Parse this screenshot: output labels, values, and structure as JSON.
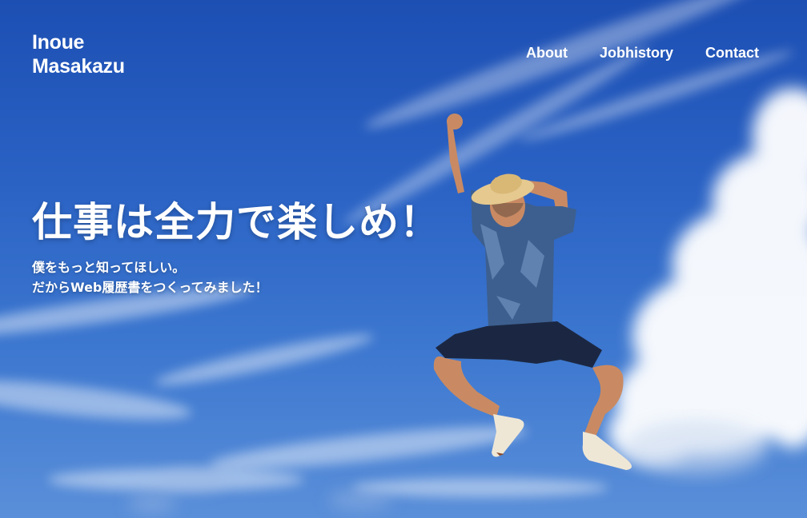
{
  "logo": {
    "line1": "Inoue",
    "line2": "Masakazu"
  },
  "nav": {
    "items": [
      {
        "label": "About"
      },
      {
        "label": "Jobhistory"
      },
      {
        "label": "Contact"
      }
    ]
  },
  "hero": {
    "headline": "仕事は全力で楽しめ！",
    "subtext_line1": "僕をもっと知ってほしい。",
    "subtext_line2": "だからWeb履歴書をつくってみました！"
  },
  "colors": {
    "sky_top": "#1d4fb3",
    "sky_bottom": "#5a8fd9",
    "text": "#ffffff"
  }
}
